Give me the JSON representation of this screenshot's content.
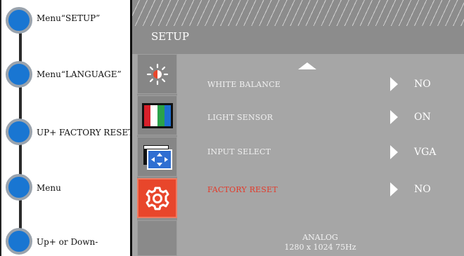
{
  "guide": {
    "steps": [
      {
        "label": "Menu“SETUP”"
      },
      {
        "label": "Menu“LANGUAGE”"
      },
      {
        "label": "UP+ FACTORY RESET"
      },
      {
        "label": "Menu"
      },
      {
        "label": "Up+ or Down-"
      }
    ]
  },
  "osd": {
    "title": "SETUP",
    "items": [
      {
        "label": "WHITE BALANCE",
        "value": "NO"
      },
      {
        "label": "LIGHT SENSOR",
        "value": "ON"
      },
      {
        "label": "INPUT SELECT",
        "value": "VGA"
      },
      {
        "label": "FACTORY RESET",
        "value": "NO"
      }
    ],
    "footer": {
      "source": "ANALOG",
      "resolution": "1280 x 1024 75Hz"
    },
    "colors": {
      "active_tile": "#e8462b",
      "highlight_text": "#e33a2a",
      "step_dot": "#1976d2"
    },
    "icons": [
      "brightness-icon",
      "color-bars-icon",
      "input-source-icon",
      "gear-icon"
    ]
  }
}
